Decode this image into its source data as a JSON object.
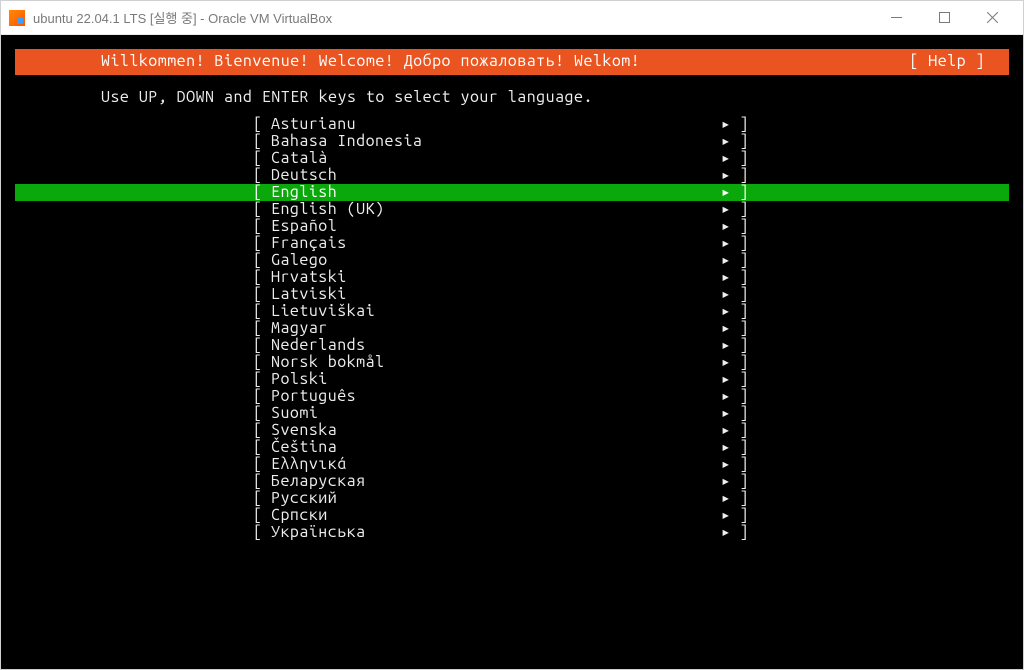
{
  "window": {
    "title": "ubuntu 22.04.1 LTS [실행 중] - Oracle VM VirtualBox"
  },
  "header": {
    "welcome": "Willkommen! Bienvenue! Welcome! Добро пожаловать! Welkom!",
    "help": "[ Help ]"
  },
  "instruction": "Use UP, DOWN and ENTER keys to select your language.",
  "selectedLanguage": "English",
  "languages": [
    {
      "label": "Asturianu",
      "selected": false
    },
    {
      "label": "Bahasa Indonesia",
      "selected": false
    },
    {
      "label": "Català",
      "selected": false
    },
    {
      "label": "Deutsch",
      "selected": false
    },
    {
      "label": "English",
      "selected": true
    },
    {
      "label": "English (UK)",
      "selected": false
    },
    {
      "label": "Español",
      "selected": false
    },
    {
      "label": "Français",
      "selected": false
    },
    {
      "label": "Galego",
      "selected": false
    },
    {
      "label": "Hrvatski",
      "selected": false
    },
    {
      "label": "Latviski",
      "selected": false
    },
    {
      "label": "Lietuviškai",
      "selected": false
    },
    {
      "label": "Magyar",
      "selected": false
    },
    {
      "label": "Nederlands",
      "selected": false
    },
    {
      "label": "Norsk bokmål",
      "selected": false
    },
    {
      "label": "Polski",
      "selected": false
    },
    {
      "label": "Português",
      "selected": false
    },
    {
      "label": "Suomi",
      "selected": false
    },
    {
      "label": "Svenska",
      "selected": false
    },
    {
      "label": "Čeština",
      "selected": false
    },
    {
      "label": "Ελληνικά",
      "selected": false
    },
    {
      "label": "Беларуская",
      "selected": false
    },
    {
      "label": "Русский",
      "selected": false
    },
    {
      "label": "Српски",
      "selected": false
    },
    {
      "label": "Українська",
      "selected": false
    }
  ],
  "brackets": {
    "open": "[",
    "close": "]",
    "arrow": "▸"
  }
}
